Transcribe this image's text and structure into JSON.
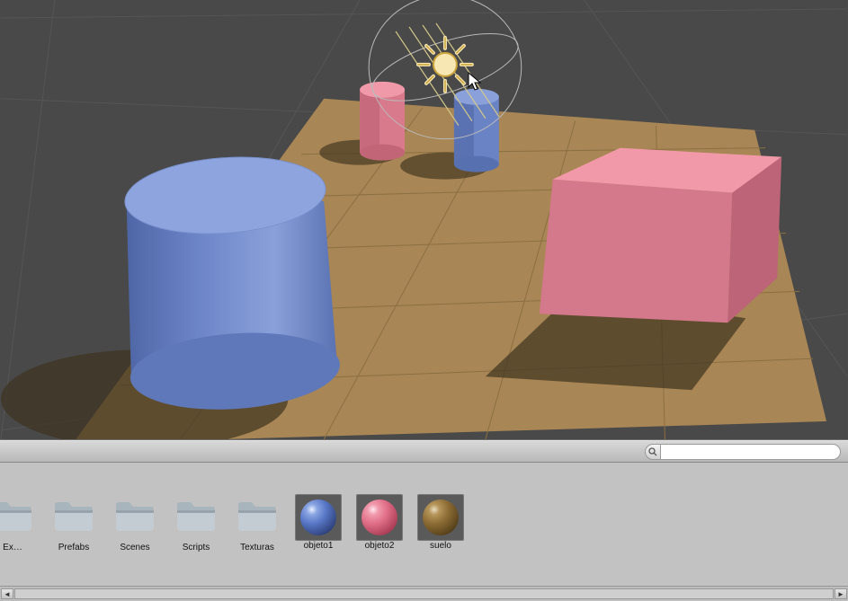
{
  "scene": {
    "light_gizmo": {
      "icon_name": "sun-icon",
      "selected": true
    },
    "objects": [
      {
        "type": "cylinder",
        "material": "objeto1",
        "role": "large-blue-cylinder"
      },
      {
        "type": "cylinder",
        "material": "objeto1",
        "role": "small-blue-cylinder"
      },
      {
        "type": "cylinder",
        "material": "objeto2",
        "role": "small-pink-cylinder"
      },
      {
        "type": "cube",
        "material": "objeto2",
        "role": "pink-cube"
      },
      {
        "type": "plane",
        "material": "suelo",
        "role": "ground-plane"
      }
    ]
  },
  "search": {
    "placeholder": ""
  },
  "project": {
    "folders": [
      {
        "name": "Ex…"
      },
      {
        "name": "Prefabs"
      },
      {
        "name": "Scenes"
      },
      {
        "name": "Scripts"
      },
      {
        "name": "Texturas"
      }
    ],
    "materials": [
      {
        "name": "objeto1",
        "swatch": "blue",
        "color": "#6d86c8"
      },
      {
        "name": "objeto2",
        "swatch": "pink",
        "color": "#e98a9a"
      },
      {
        "name": "suelo",
        "swatch": "brown",
        "color": "#9a7a4a"
      }
    ]
  },
  "colors": {
    "sky": "#4a4a4a",
    "ground_plane": "#a88655",
    "blue_material": "#6d86c8",
    "pink_material": "#e98a9a",
    "shadow": "#433826"
  }
}
